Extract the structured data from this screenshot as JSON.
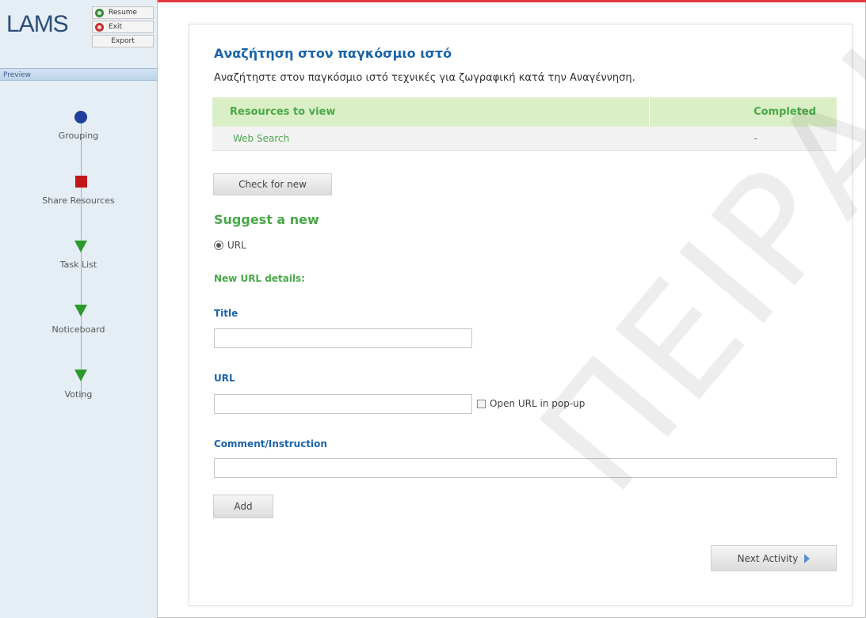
{
  "sidebar": {
    "logo": "LAMS",
    "resume_label": "Resume",
    "exit_label": "Exit",
    "export_label": "Export",
    "preview_label": "Preview",
    "activities": [
      {
        "label": "Grouping",
        "icon": "circle-icon"
      },
      {
        "label": "Share Resources",
        "icon": "square-icon"
      },
      {
        "label": "Task List",
        "icon": "triangle-icon"
      },
      {
        "label": "Noticeboard",
        "icon": "triangle-icon"
      },
      {
        "label": "Voting",
        "icon": "triangle-icon"
      }
    ]
  },
  "main": {
    "title": "Αναζήτηση στον παγκόσμιο ιστό",
    "instructions": "Αναζήτηστε στον παγκόσμιο ιστό τεχνικές για ζωγραφική κατά την Αναγέννηση.",
    "table": {
      "headers": [
        "Resources to view",
        "Completed"
      ],
      "rows": [
        {
          "resource": "Web Search",
          "completed": "-"
        }
      ]
    },
    "check_for_new_label": "Check for new",
    "suggest_title": "Suggest a new",
    "radio_url_label": "URL",
    "new_url_details_label": "New URL details:",
    "title_label": "Title",
    "title_value": "",
    "url_label": "URL",
    "url_value": "",
    "popup_label": "Open URL in pop-up",
    "comment_label": "Comment/Instruction",
    "comment_value": "",
    "add_label": "Add",
    "next_activity_label": "Next Activity"
  },
  "watermark": "ΠΕΙΡΑΙΑ",
  "colors": {
    "title_blue": "#1a64a8",
    "green": "#49a849",
    "header_green_bg": "#dbefc6",
    "sidebar_bg": "#e6eef5",
    "top_red": "#e03a3a"
  }
}
